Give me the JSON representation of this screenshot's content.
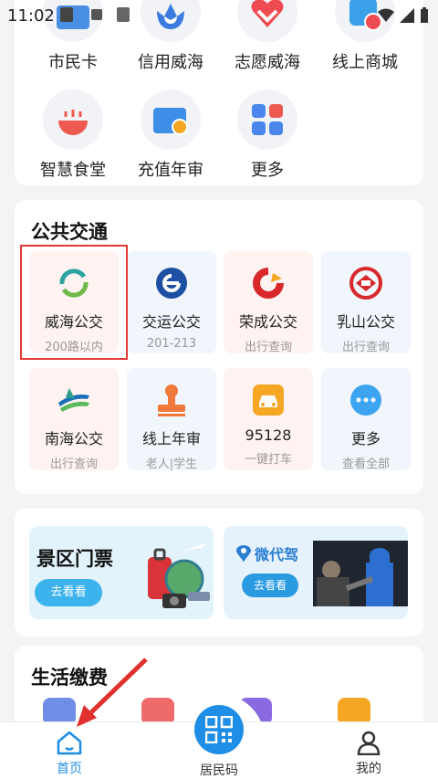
{
  "status_bar": {
    "time": "11:02"
  },
  "top_services": {
    "row1": [
      {
        "label": "市民卡",
        "icon": "citizen-card-icon"
      },
      {
        "label": "信用威海",
        "icon": "credit-tulip-icon"
      },
      {
        "label": "志愿威海",
        "icon": "volunteer-heart-icon"
      },
      {
        "label": "线上商城",
        "icon": "online-mall-icon"
      }
    ],
    "row2": [
      {
        "label": "智慧食堂",
        "icon": "canteen-bowl-icon"
      },
      {
        "label": "充值年审",
        "icon": "recharge-card-icon"
      },
      {
        "label": "更多",
        "icon": "more-grid-icon"
      }
    ]
  },
  "public_transport": {
    "title": "公共交通",
    "tiles": [
      {
        "name": "威海公交",
        "sub": "200路以内",
        "icon": "weihai-bus-icon"
      },
      {
        "name": "交运公交",
        "sub": "201-213",
        "icon": "jiaoyun-bus-icon"
      },
      {
        "name": "荣成公交",
        "sub": "出行查询",
        "icon": "rongcheng-bus-icon"
      },
      {
        "name": "乳山公交",
        "sub": "出行查询",
        "icon": "rushan-bus-icon"
      },
      {
        "name": "南海公交",
        "sub": "出行查询",
        "icon": "nanhai-bus-icon"
      },
      {
        "name": "线上年审",
        "sub": "老人|学生",
        "icon": "stamp-icon"
      },
      {
        "name": "95128",
        "sub": "一键打车",
        "icon": "taxi-icon"
      },
      {
        "name": "更多",
        "sub": "查看全部",
        "icon": "more-dots-icon"
      }
    ]
  },
  "promos": {
    "scenic": {
      "title": "景区门票",
      "button": "去看看"
    },
    "daijia": {
      "logo_text": "微代驾",
      "button": "去看看"
    }
  },
  "life_payment": {
    "title": "生活缴费"
  },
  "bottom_nav": {
    "home": "首页",
    "resident_code": "居民码",
    "mine": "我的"
  },
  "colors": {
    "accent": "#1f8ee6",
    "highlight": "#e53935",
    "button": "#3cb3ec"
  }
}
